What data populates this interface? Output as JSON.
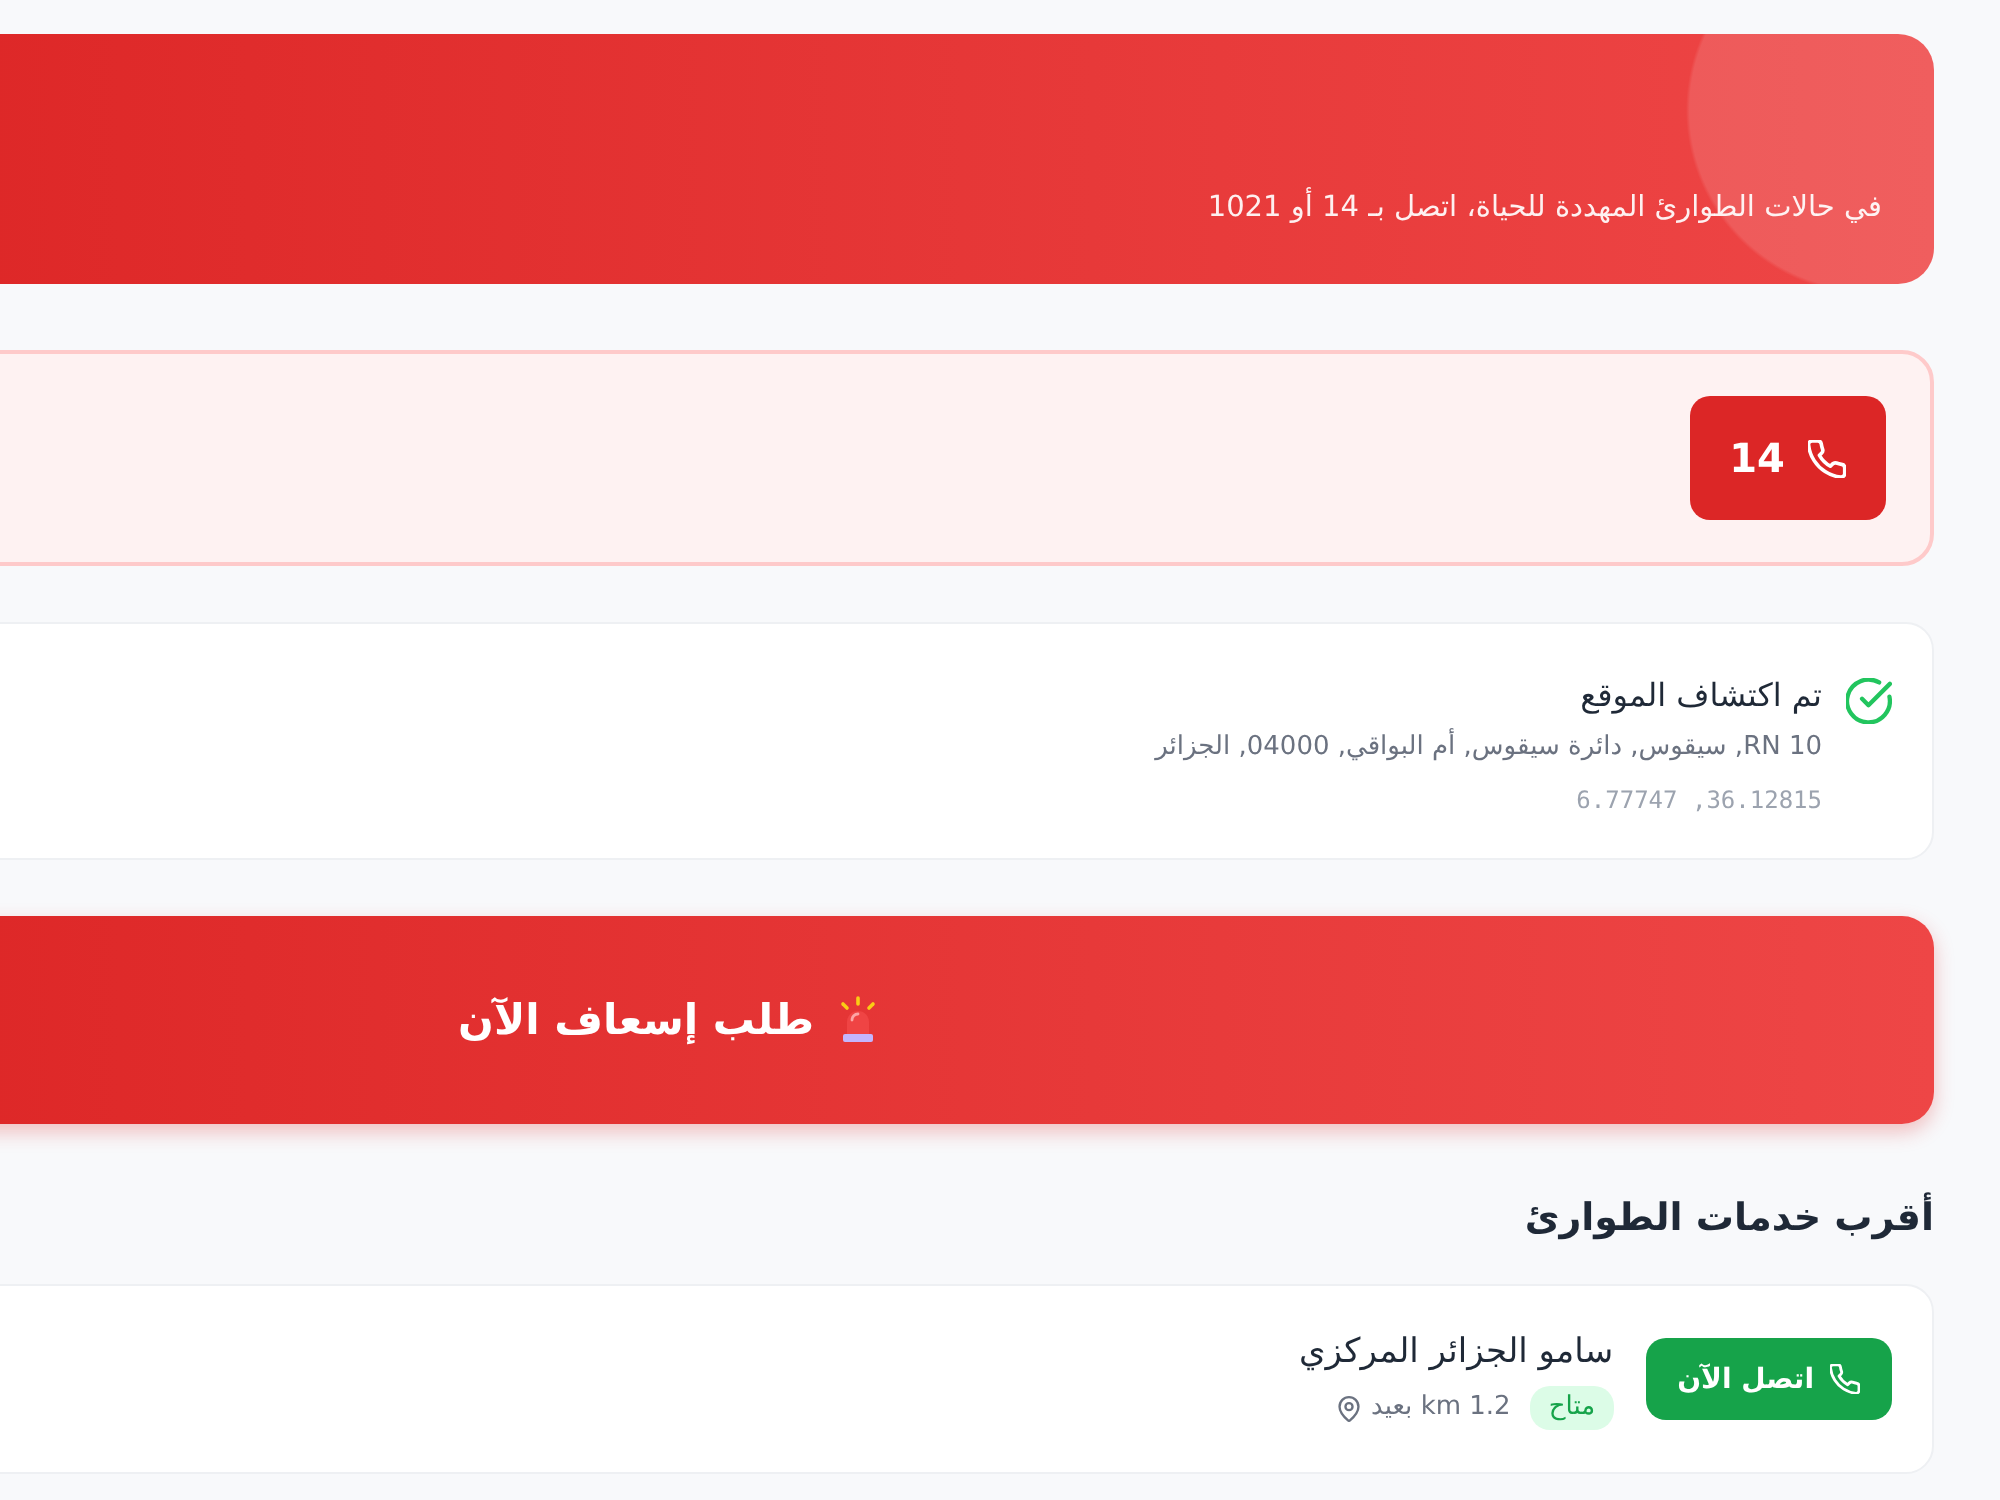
{
  "alert_banner": {
    "subtitle": "في حالات الطوارئ المهددة للحياة، اتصل بـ 14 أو 1021"
  },
  "hotlines": [
    {
      "number": "14"
    }
  ],
  "location": {
    "detected": true,
    "status": "تم اكتشاف الموقع",
    "address": "RN 10, سيقوس, دائرة سيقوس, أم البواقي, 04000, الجزائر",
    "coordinates": "36.12815, 6.77747"
  },
  "emergency_button": {
    "label": "طلب إسعاف الآن"
  },
  "nearby": {
    "title": "أقرب خدمات الطوارئ",
    "services": [
      {
        "name": "سامو الجزائر المركزي",
        "status": "متاح",
        "available": true,
        "distance": "1.2 km بعيد",
        "call_label": "اتصل الآن"
      }
    ]
  }
}
